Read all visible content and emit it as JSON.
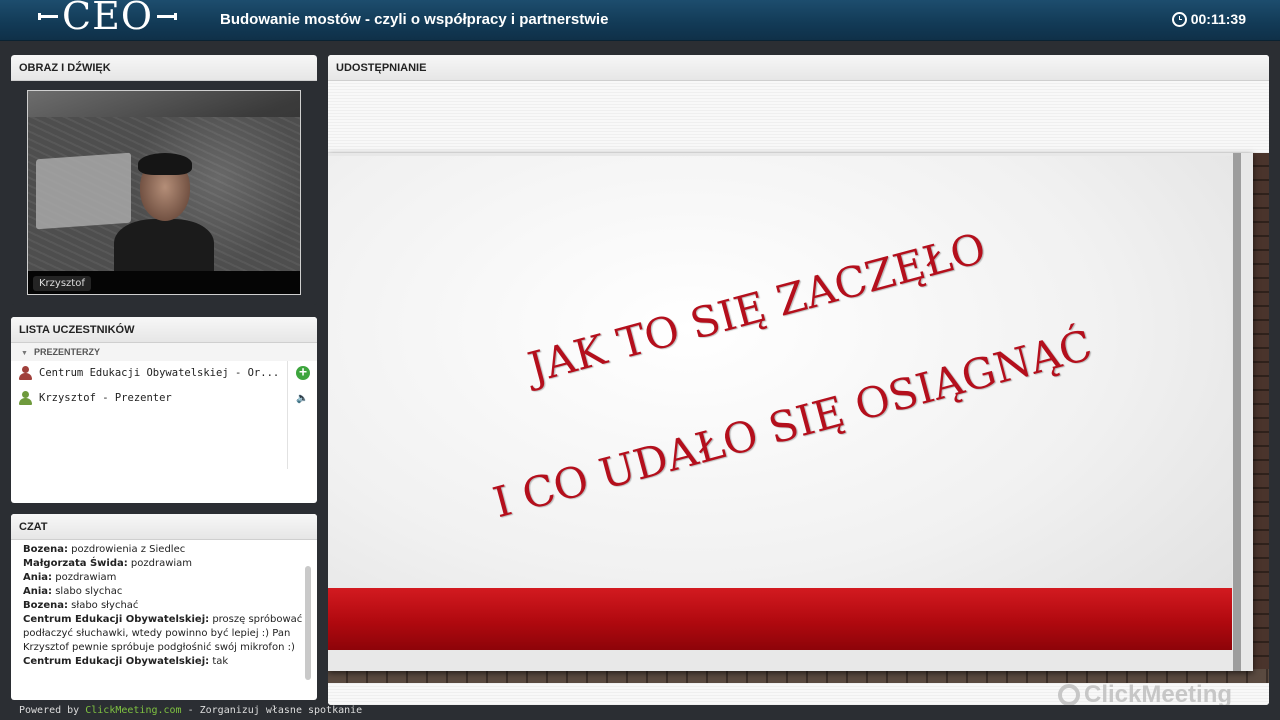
{
  "header": {
    "logo_text": "CEO",
    "meeting_title": "Budowanie mostów - czyli o współpracy i partnerstwie",
    "timer": "00:11:39",
    "timer_icon": "clock-icon"
  },
  "av_panel": {
    "title": "OBRAZ I DŹWIĘK",
    "video_name": "Krzysztof"
  },
  "participants_panel": {
    "title": "LISTA UCZESTNIKÓW",
    "group": "PREZENTERZY",
    "items": [
      {
        "name": "Centrum Edukacji Obywatelskiej - Or...",
        "icon": "user-icon-red",
        "action": "plus-icon"
      },
      {
        "name": "Krzysztof - Prezenter",
        "icon": "user-icon-green",
        "action": "speaker-icon"
      }
    ]
  },
  "chat_panel": {
    "title": "CZAT",
    "messages": [
      {
        "author": "Bozena:",
        "text": " pozdrowienia z Siedlec"
      },
      {
        "author": "Małgorzata Świda:",
        "text": " pozdrawiam"
      },
      {
        "author": "Ania:",
        "text": " pozdrawiam"
      },
      {
        "author": "Ania:",
        "text": " slabo slychac"
      },
      {
        "author": "Bozena:",
        "text": " słabo słychać"
      },
      {
        "author": "Centrum Edukacji Obywatelskiej:",
        "text": " proszę spróbować podłaczyć słuchawki, wtedy powinno być lepiej :) Pan Krzysztof pewnie spróbuje podgłośnić swój mikrofon :)"
      },
      {
        "author": "Centrum Edukacji Obywatelskiej:",
        "text": " tak"
      }
    ]
  },
  "share_panel": {
    "title": "UDOSTĘPNIANIE",
    "slide_line_1": "JAK TO SIĘ ZACZĘŁO",
    "slide_line_2": "I CO UDAŁO SIĘ OSIĄGNĄĆ",
    "watermark": "ClickMeeting"
  },
  "footer": {
    "prefix": "Powered by ",
    "link": "ClickMeeting.com",
    "suffix": " - Zorganizuj własne spotkanie"
  },
  "colors": {
    "header_bg": "#123a56",
    "slide_text": "#b40f1c",
    "slide_band": "#c00d14",
    "link_green": "#7fc241"
  }
}
